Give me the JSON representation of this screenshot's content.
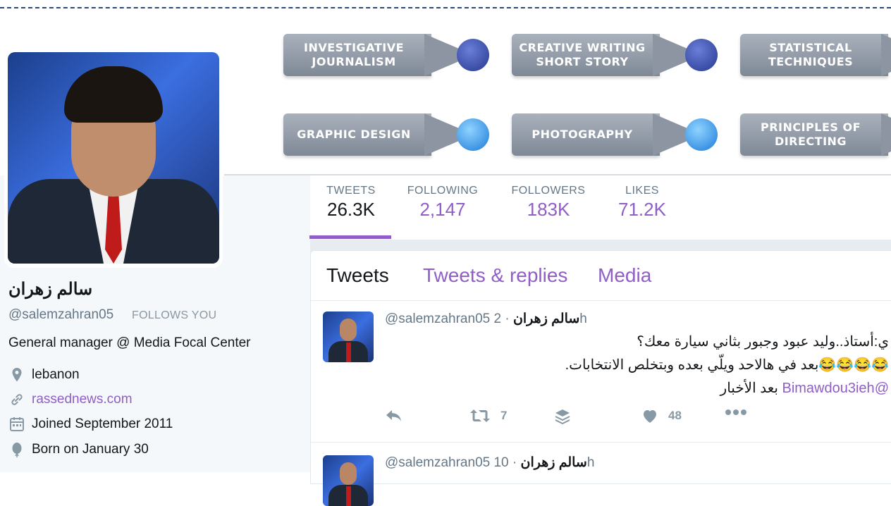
{
  "banner": {
    "pills": [
      {
        "label": "INVESTIGATIVE\nJOURNALISM",
        "dot": "dark"
      },
      {
        "label": "CREATIVE WRITING\nSHORT STORY",
        "dot": "dark"
      },
      {
        "label": "STATISTICAL\nTECHNIQUES",
        "dot": "dark"
      },
      {
        "label": "GRAPHIC DESIGN",
        "dot": "light"
      },
      {
        "label": "PHOTOGRAPHY",
        "dot": "light"
      },
      {
        "label": "PRINCIPLES OF\nDIRECTING",
        "dot": "light"
      }
    ]
  },
  "profile": {
    "name": "سالم زهران",
    "handle": "@salemzahran05",
    "follows_you": "FOLLOWS YOU",
    "bio": "General manager @ Media Focal Center",
    "location": "lebanon",
    "website": "rassednews.com",
    "joined": "Joined September 2011",
    "born": "Born on January 30"
  },
  "stats": [
    {
      "label": "TWEETS",
      "value": "26.3K"
    },
    {
      "label": "FOLLOWING",
      "value": "2,147"
    },
    {
      "label": "FOLLOWERS",
      "value": "183K"
    },
    {
      "label": "LIKES",
      "value": "71.2K"
    }
  ],
  "tabs": {
    "tweets": "Tweets",
    "replies": "Tweets & replies",
    "media": "Media"
  },
  "tweets": [
    {
      "name": "سالم زهران",
      "handle": "@salemzahran05",
      "time": "· 2h",
      "line1": "ي:أستاذ..وليد عبود وجبور بثاني سيارة معك؟",
      "line2": "😂😂😂😂بعد في هالاحد ويلّي بعده وبتخلص الانتخابات.",
      "line3_mention": "@Bimawdou3ieh",
      "line3_text": "بعد الأخبار",
      "retweets": "7",
      "likes": "48"
    },
    {
      "name": "سالم زهران",
      "handle": "@salemzahran05",
      "time": "· 10h"
    }
  ],
  "colors": {
    "accent": "#8f5ec6",
    "muted": "#657786",
    "icon": "#8899a6"
  }
}
